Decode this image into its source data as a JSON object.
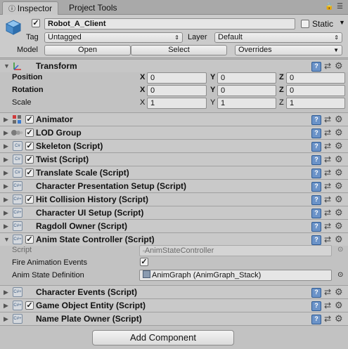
{
  "tabs": [
    {
      "label": "Inspector",
      "active": true
    },
    {
      "label": "Project Tools",
      "active": false
    }
  ],
  "header": {
    "object_name": "Robot_A_Client",
    "static_label": "Static",
    "tag_label": "Tag",
    "tag_value": "Untagged",
    "layer_label": "Layer",
    "layer_value": "Default",
    "model_label": "Model",
    "open_label": "Open",
    "select_label": "Select",
    "overrides_label": "Overrides"
  },
  "transform": {
    "title": "Transform",
    "rows": [
      {
        "label": "Position",
        "x": "0",
        "y": "0",
        "z": "0"
      },
      {
        "label": "Rotation",
        "x": "0",
        "y": "0",
        "z": "0"
      },
      {
        "label": "Scale",
        "x": "1",
        "y": "1",
        "z": "1"
      }
    ],
    "axis": {
      "x": "X",
      "y": "Y",
      "z": "Z"
    }
  },
  "components": [
    {
      "title": "Animator"
    },
    {
      "title": "LOD Group"
    },
    {
      "title": "Skeleton (Script)"
    },
    {
      "title": "Twist (Script)"
    },
    {
      "title": "Translate Scale (Script)"
    },
    {
      "title": "Character Presentation Setup (Script)"
    },
    {
      "title": "Hit Collision History (Script)"
    },
    {
      "title": "Character UI Setup (Script)"
    },
    {
      "title": "Ragdoll Owner (Script)"
    },
    {
      "title": "Anim State Controller (Script)"
    },
    {
      "title": "Character Events (Script)"
    },
    {
      "title": "Game Object Entity (Script)"
    },
    {
      "title": "Name Plate Owner (Script)"
    }
  ],
  "anim_state": {
    "script_label": "Script",
    "script_value": "AnimStateController",
    "fire_label": "Fire Animation Events",
    "def_label": "Anim State Definition",
    "def_value": "AnimGraph (AnimGraph_Stack)"
  },
  "add_component_label": "Add Component",
  "colors": {
    "panel": "#c2c2c2",
    "help_icon": "#6b93c8"
  }
}
